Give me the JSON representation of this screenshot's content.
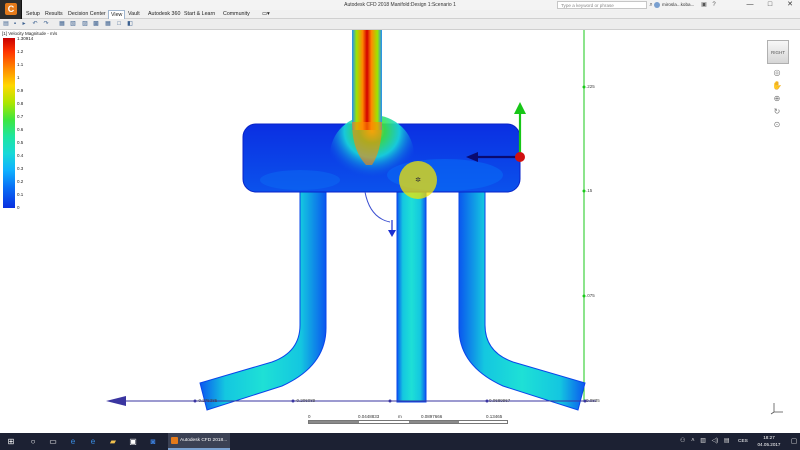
{
  "window": {
    "title": "Autodesk CFD 2018   Manifold:Design 1:Scenario 1",
    "search_placeholder": "Type a keyword or phrase",
    "user": "mirosla...koba...",
    "controls": [
      "—",
      "□",
      "✕"
    ]
  },
  "menubar": {
    "items": [
      "Setup",
      "Results",
      "Decision Center",
      "View",
      "Vault",
      "Autodesk 360",
      "Start & Learn",
      "Community"
    ],
    "active": "View"
  },
  "legend": {
    "title": "[1] Velocity Magnitude - m/s",
    "max_label": "1.30914",
    "ticks": [
      "1.2",
      "1.1",
      "1",
      "0.9",
      "0.8",
      "0.7",
      "0.6",
      "0.5",
      "0.4",
      "0.3",
      "0.2",
      "0.1",
      "0"
    ]
  },
  "view_cube": {
    "label": "RIGHT"
  },
  "axis_labels": {
    "right_top": ".225",
    "right_mid": ".15",
    "right_low": ".075",
    "right_bottom": "0.0835",
    "bottom_left": "-0.275385",
    "bottom_mid": "-0.206089",
    "bottom_right": "0.0689967"
  },
  "scale": {
    "labels": [
      "0",
      "0.0448833",
      "m",
      "0.0897666",
      "0.13465"
    ]
  },
  "taskbar": {
    "app_label": "Autodesk CFD 2018...",
    "language": "CES",
    "time": "18:27",
    "date": "04.05.2017"
  },
  "colors": {
    "flow_low": "#0a2fe0",
    "flow_mid": "#18d9d9",
    "flow_high": "#c80000",
    "axis_line": "#3a35a0",
    "scale_line": "#19c819"
  }
}
